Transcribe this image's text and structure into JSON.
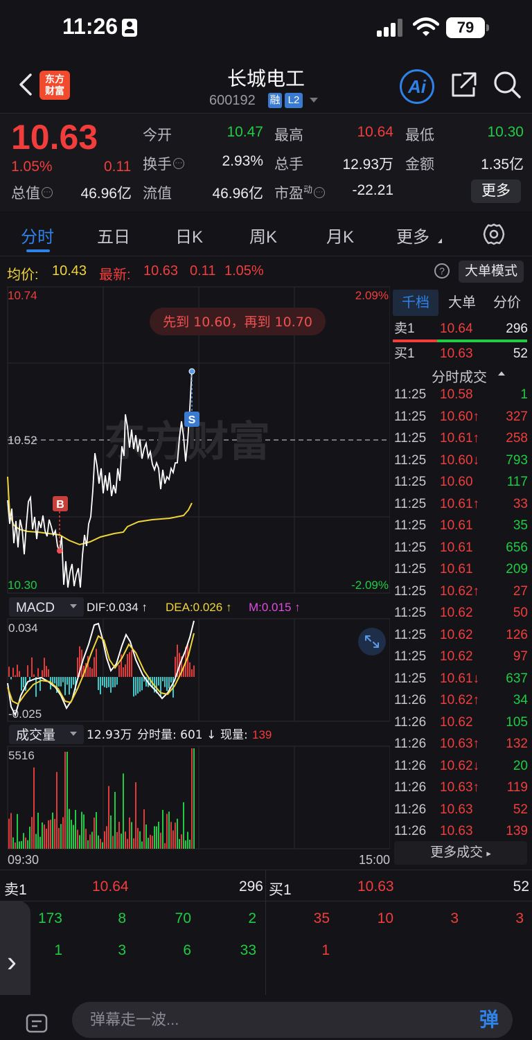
{
  "status_bar": {
    "time": "11:26",
    "battery": "79"
  },
  "header": {
    "logo_text": "东方\n财富",
    "stock_name": "长城电工",
    "stock_code": "600192",
    "tag_margin": "融",
    "tag_level": "L2",
    "ai_label": "Ai"
  },
  "quote": {
    "last_price": "10.63",
    "pct_change": "1.05%",
    "abs_change": "0.11",
    "fields": [
      {
        "label": "今开",
        "value": "10.47",
        "color": "green"
      },
      {
        "label": "最高",
        "value": "10.64",
        "color": "red"
      },
      {
        "label": "最低",
        "value": "10.30",
        "color": "green"
      },
      {
        "label": "换手",
        "value": "2.93%",
        "color": "white"
      },
      {
        "label": "总手",
        "value": "12.93万",
        "color": "white"
      },
      {
        "label": "金额",
        "value": "1.35亿",
        "color": "white"
      },
      {
        "label": "总值",
        "value": "46.96亿",
        "color": "white"
      },
      {
        "label": "流值",
        "value": "46.96亿",
        "color": "white"
      },
      {
        "label": "市盈",
        "value": "-22.21",
        "color": "white"
      }
    ],
    "pe_sup": "动",
    "info_glyph": "···",
    "more_label": "更多"
  },
  "tabs": [
    "分时",
    "五日",
    "日K",
    "周K",
    "月K",
    "更多"
  ],
  "info_line": {
    "avg_label": "均价:",
    "avg_value": "10.43",
    "latest_label": "最新:",
    "latest_value": "10.63",
    "latest_change": "0.11",
    "latest_pct": "1.05%",
    "help": "?",
    "big_order_label": "大单模式"
  },
  "chart": {
    "price_top": "10.74",
    "price_mid": "10.52",
    "price_bottom": "10.30",
    "pct_top": "2.09%",
    "pct_bottom": "-2.09%",
    "watermark": "东方财富",
    "target_banner": "先到 10.60，再到 10.70",
    "buy_marker": "B",
    "sell_marker": "S",
    "macd_label": "MACD",
    "macd_dif": "DIF:0.034 ↑",
    "macd_dea": "DEA:0.026 ↑",
    "macd_m": "M:0.015 ↑",
    "macd_top": "0.034",
    "macd_bottom": "-0.025",
    "volume_label": "成交量",
    "volume_total": "12.93万",
    "volume_minute": "分时量: 601 ↓",
    "volume_now_label": "现量:",
    "volume_now": "139",
    "volume_top": "5516",
    "time_start": "09:30",
    "time_end": "15:00",
    "colors": {
      "up": "#f23d3d",
      "down": "#1fcc44",
      "avg": "#f0d43a",
      "price": "#ffffff"
    }
  },
  "right_panel": {
    "tabs": [
      "千档",
      "大单",
      "分价"
    ],
    "ask": {
      "label": "卖1",
      "price": "10.64",
      "volume": "296"
    },
    "bid": {
      "label": "买1",
      "price": "10.63",
      "volume": "52"
    },
    "ticks_title": "分时成交",
    "ticks": [
      {
        "time": "11:25",
        "price": "10.58",
        "volume": "1",
        "pc": "red",
        "vc": "green"
      },
      {
        "time": "11:25",
        "price": "10.60↑",
        "volume": "327",
        "pc": "red",
        "vc": "red"
      },
      {
        "time": "11:25",
        "price": "10.61↑",
        "volume": "258",
        "pc": "red",
        "vc": "red"
      },
      {
        "time": "11:25",
        "price": "10.60↓",
        "volume": "793",
        "pc": "red",
        "vc": "green"
      },
      {
        "time": "11:25",
        "price": "10.60",
        "volume": "117",
        "pc": "red",
        "vc": "green"
      },
      {
        "time": "11:25",
        "price": "10.61↑",
        "volume": "33",
        "pc": "red",
        "vc": "red"
      },
      {
        "time": "11:25",
        "price": "10.61",
        "volume": "35",
        "pc": "red",
        "vc": "green"
      },
      {
        "time": "11:25",
        "price": "10.61",
        "volume": "656",
        "pc": "red",
        "vc": "green"
      },
      {
        "time": "11:25",
        "price": "10.61",
        "volume": "209",
        "pc": "red",
        "vc": "green"
      },
      {
        "time": "11:25",
        "price": "10.62↑",
        "volume": "27",
        "pc": "red",
        "vc": "red"
      },
      {
        "time": "11:25",
        "price": "10.62",
        "volume": "50",
        "pc": "red",
        "vc": "red"
      },
      {
        "time": "11:25",
        "price": "10.62",
        "volume": "126",
        "pc": "red",
        "vc": "red"
      },
      {
        "time": "11:25",
        "price": "10.62",
        "volume": "97",
        "pc": "red",
        "vc": "red"
      },
      {
        "time": "11:25",
        "price": "10.61↓",
        "volume": "637",
        "pc": "red",
        "vc": "green"
      },
      {
        "time": "11:26",
        "price": "10.62↑",
        "volume": "34",
        "pc": "red",
        "vc": "green"
      },
      {
        "time": "11:26",
        "price": "10.62",
        "volume": "105",
        "pc": "red",
        "vc": "green"
      },
      {
        "time": "11:26",
        "price": "10.63↑",
        "volume": "132",
        "pc": "red",
        "vc": "red"
      },
      {
        "time": "11:26",
        "price": "10.62↓",
        "volume": "20",
        "pc": "red",
        "vc": "green"
      },
      {
        "time": "11:26",
        "price": "10.63↑",
        "volume": "119",
        "pc": "red",
        "vc": "red"
      },
      {
        "time": "11:26",
        "price": "10.63",
        "volume": "52",
        "pc": "red",
        "vc": "red"
      },
      {
        "time": "11:26",
        "price": "10.63",
        "volume": "139",
        "pc": "red",
        "vc": "red"
      }
    ],
    "more_ticks": "更多成交"
  },
  "order_book": {
    "sell_label": "卖1",
    "sell_price": "10.64",
    "sell_volume": "296",
    "buy_label": "买1",
    "buy_price": "10.63",
    "buy_volume": "52",
    "sell_queue_row1": [
      {
        "v": "173",
        "c": "green"
      },
      {
        "v": "8",
        "c": "green"
      },
      {
        "v": "70",
        "c": "green"
      },
      {
        "v": "2",
        "c": "green"
      }
    ],
    "sell_queue_row2": [
      {
        "v": "1",
        "c": "green"
      },
      {
        "v": "3",
        "c": "green"
      },
      {
        "v": "6",
        "c": "green"
      },
      {
        "v": "33",
        "c": "green"
      }
    ],
    "buy_queue_row1": [
      {
        "v": "35",
        "c": "red"
      },
      {
        "v": "10",
        "c": "red"
      },
      {
        "v": "3",
        "c": "red"
      },
      {
        "v": "3",
        "c": "red"
      }
    ],
    "buy_queue_row2": [
      {
        "v": "1",
        "c": "red"
      }
    ]
  },
  "bottom_bar": {
    "danmu_placeholder": "弹幕走一波...",
    "danmu_button": "弹"
  }
}
